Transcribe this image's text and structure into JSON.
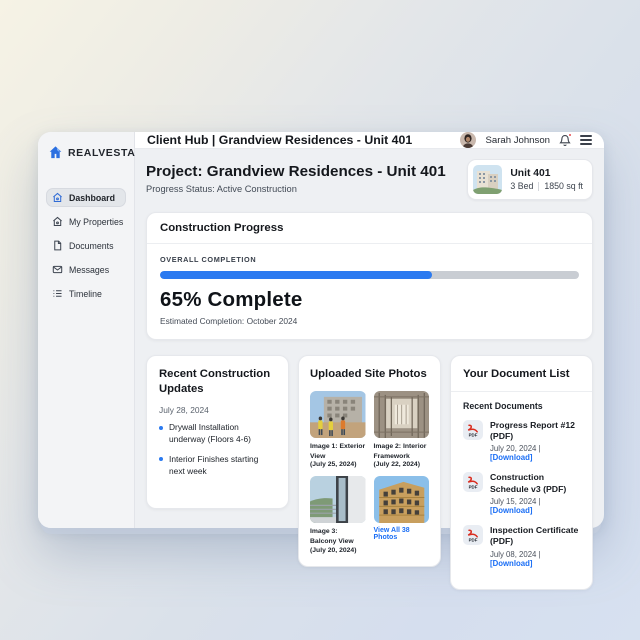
{
  "app": {
    "brand": "REALVESTA"
  },
  "topbar": {
    "title": "Client Hub | Grandview Residences - Unit 401",
    "user_name": "Sarah Johnson",
    "icons": [
      "avatar",
      "bell-icon",
      "menu-icon"
    ]
  },
  "sidebar": {
    "items": [
      {
        "label": "Dashboard",
        "icon": "home-icon",
        "active": true
      },
      {
        "label": "My Properties",
        "icon": "building-icon",
        "active": false
      },
      {
        "label": "Documents",
        "icon": "file-icon",
        "active": false
      },
      {
        "label": "Messages",
        "icon": "mail-icon",
        "active": false
      },
      {
        "label": "Timeline",
        "icon": "list-icon",
        "active": false
      }
    ]
  },
  "project": {
    "title": "Project: Grandview Residences - Unit 401",
    "status": "Progress Status: Active Construction"
  },
  "unit": {
    "name": "Unit 401",
    "beds": "3 Bed",
    "area": "1850 sq ft",
    "thumb": "building-photo"
  },
  "progress": {
    "title": "Construction Progress",
    "label": "OVERALL COMPLETION",
    "percent": 65,
    "headline": "65% Complete",
    "estimate": "Estimated Completion: October 2024"
  },
  "updates": {
    "title": "Recent Construction Updates",
    "date": "July 28, 2024",
    "items": [
      "Drywall Installation underway (Floors 4-6)",
      "Interior Finishes starting next week"
    ]
  },
  "photos": {
    "title": "Uploaded Site Photos",
    "items": [
      {
        "caption": "Image 1: Exterior View",
        "date": "(July 25, 2024)",
        "image": "exterior-construction-workers-photo"
      },
      {
        "caption": "Image 2: Interior Framework",
        "date": "(July 22, 2024)",
        "image": "interior-framing-photo"
      },
      {
        "caption": "Image 3: Balcony View",
        "date": "(July 20, 2024)",
        "image": "balcony-photo"
      },
      {
        "caption": "",
        "date": "",
        "image": "timber-building-photo"
      }
    ],
    "view_all": "View All 38 Photos"
  },
  "documents": {
    "title": "Your Document List",
    "subtitle": "Recent Documents",
    "separator": "|",
    "items": [
      {
        "name": "Progress Report #12 (PDF)",
        "date": "July 20, 2024",
        "action": "[Download]",
        "icon": "pdf-icon"
      },
      {
        "name": "Construction Schedule v3 (PDF)",
        "date": "July 15, 2024",
        "action": "[Download]",
        "icon": "pdf-icon"
      },
      {
        "name": "Inspection Certificate (PDF)",
        "date": "July 08, 2024",
        "action": "[Download]",
        "icon": "pdf-icon"
      }
    ]
  },
  "colors": {
    "accent_blue": "#2b7af0",
    "link_blue": "#1a6ef5",
    "notification_red": "#e5484d",
    "progress_track": "#c9cdd3"
  }
}
